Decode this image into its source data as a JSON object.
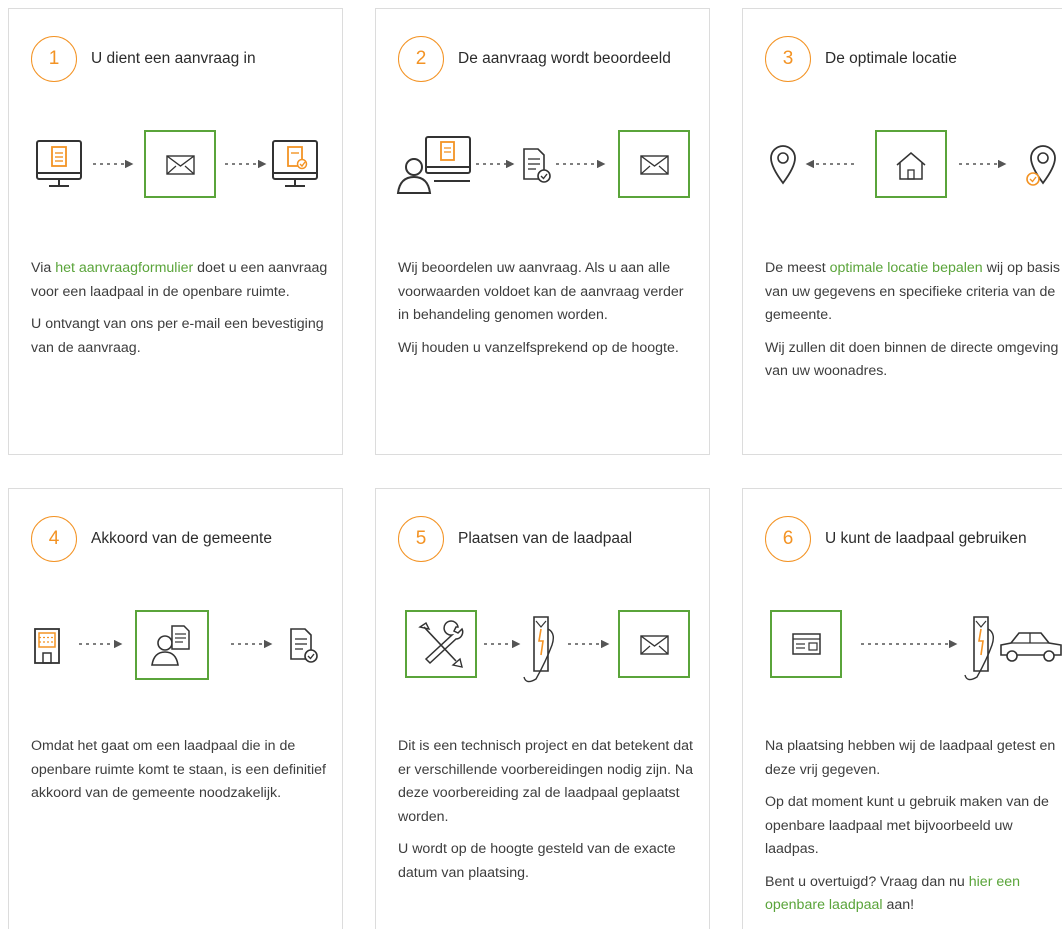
{
  "colors": {
    "accent_orange": "#f39324",
    "accent_green": "#5aa43a",
    "border": "#dcdcdc",
    "icon_dark": "#333333"
  },
  "steps": [
    {
      "number": "1",
      "title": "U dient een aanvraag in",
      "icons": [
        "monitor-document-icon",
        "envelope-icon",
        "monitor-approved-icon"
      ],
      "p1_before": "Via ",
      "p1_link": "het aanvraagformulier",
      "p1_after": " doet u een aanvraag voor een laadpaal in de openbare ruimte.",
      "p2": "U ontvangt van ons per e-mail een bevestiging van de aanvraag."
    },
    {
      "number": "2",
      "title": "De aanvraag wordt beoordeeld",
      "icons": [
        "user-monitor-icon",
        "document-check-icon",
        "envelope-icon"
      ],
      "p1": "Wij beoordelen uw aanvraag. Als u aan alle voorwaarden voldoet kan de aanvraag verder in behandeling genomen worden.",
      "p2": "Wij houden u vanzelfsprekend op de hoogte."
    },
    {
      "number": "3",
      "title": "De optimale locatie",
      "icons": [
        "location-pin-icon",
        "house-icon",
        "location-pin-check-icon"
      ],
      "p1_before": "De meest ",
      "p1_link": "optimale locatie bepalen",
      "p1_after": " wij op basis van uw gegevens en specifieke criteria van de gemeente.",
      "p2": "Wij zullen dit doen binnen de directe omgeving van uw woonadres."
    },
    {
      "number": "4",
      "title": "Akkoord van de gemeente",
      "icons": [
        "municipality-building-icon",
        "person-document-icon",
        "document-check-icon"
      ],
      "p1": "Omdat het gaat om een laadpaal die in de openbare ruimte komt te staan, is een definitief akkoord van de gemeente noodzakelijk."
    },
    {
      "number": "5",
      "title": "Plaatsen van de laadpaal",
      "icons": [
        "tools-icon",
        "charging-pole-icon",
        "envelope-icon"
      ],
      "p1": "Dit is een technisch project en dat betekent dat er verschillende voorbereidingen nodig zijn. Na deze voorbereiding zal de laadpaal geplaatst worden.",
      "p2": "U wordt op de hoogte gesteld van de exacte datum van plaatsing."
    },
    {
      "number": "6",
      "title": "U kunt de laadpaal gebruiken",
      "icons": [
        "charge-card-icon",
        "charging-pole-icon",
        "car-icon"
      ],
      "p1": "Na plaatsing hebben wij de laadpaal getest en deze vrij gegeven.",
      "p2": "Op dat moment kunt u gebruik maken van de openbare laadpaal met bijvoorbeeld uw laadpas.",
      "p3_before": "Bent u overtuigd? Vraag dan nu ",
      "p3_link": "hier een openbare laadpaal",
      "p3_after": " aan!"
    }
  ]
}
